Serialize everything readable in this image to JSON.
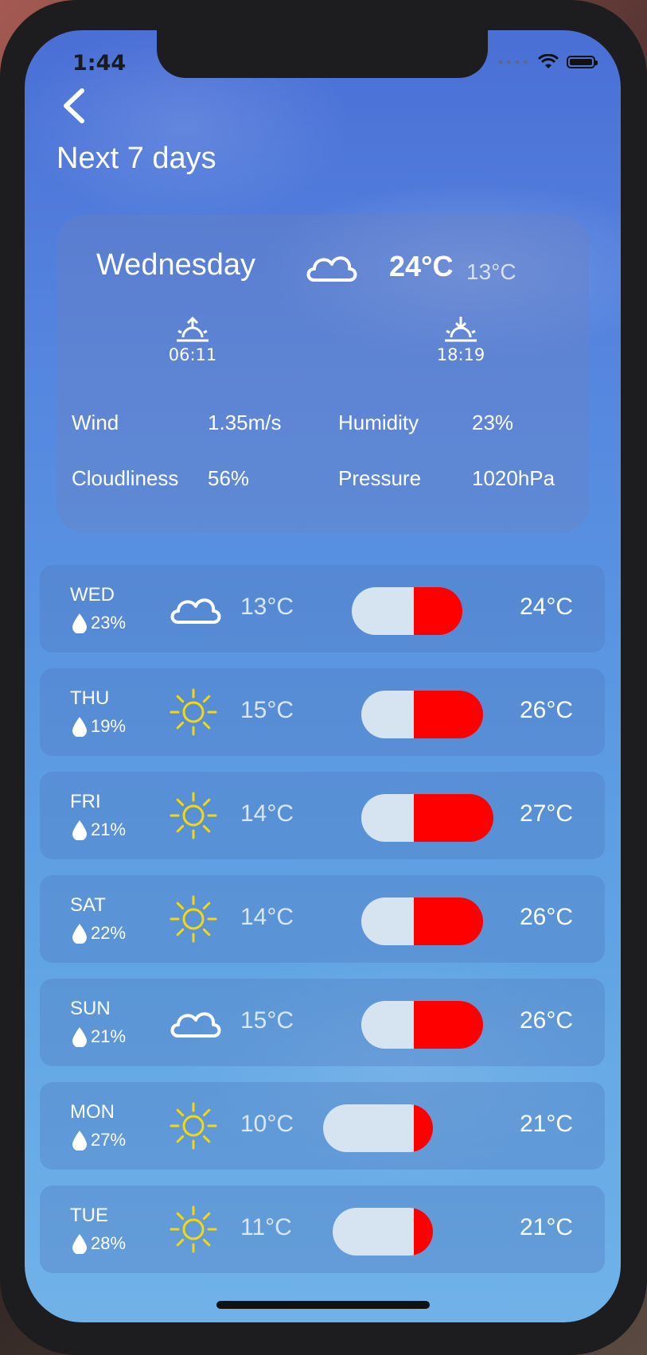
{
  "status": {
    "time": "1:44"
  },
  "header": {
    "title": "Next 7 days"
  },
  "summary": {
    "day": "Wednesday",
    "icon": "cloud-icon",
    "high": "24°C",
    "low": "13°C",
    "sunrise": "06:11",
    "sunset": "18:19",
    "metrics": {
      "wind_label": "Wind",
      "wind_value": "1.35m/s",
      "humidity_label": "Humidity",
      "humidity_value": "23%",
      "cloudiness_label": "Cloudliness",
      "cloudiness_value": "56%",
      "pressure_label": "Pressure",
      "pressure_value": "1020hPa"
    }
  },
  "colors": {
    "hot": "#ff0000",
    "cold": "#d6e4f2",
    "sun": "#f5d80a"
  },
  "forecast": [
    {
      "day": "WED",
      "precip": "23%",
      "icon": "cloud-icon",
      "low": "13°C",
      "high": "24°C",
      "low_value": 13,
      "high_value": 24
    },
    {
      "day": "THU",
      "precip": "19%",
      "icon": "sun-icon",
      "low": "15°C",
      "high": "26°C",
      "low_value": 15,
      "high_value": 26
    },
    {
      "day": "FRI",
      "precip": "21%",
      "icon": "sun-icon",
      "low": "14°C",
      "high": "27°C",
      "low_value": 14,
      "high_value": 27
    },
    {
      "day": "SAT",
      "precip": "22%",
      "icon": "sun-icon",
      "low": "14°C",
      "high": "26°C",
      "low_value": 14,
      "high_value": 26
    },
    {
      "day": "SUN",
      "precip": "21%",
      "icon": "cloud-icon",
      "low": "15°C",
      "high": "26°C",
      "low_value": 15,
      "high_value": 26
    },
    {
      "day": "MON",
      "precip": "27%",
      "icon": "sun-icon",
      "low": "10°C",
      "high": "21°C",
      "low_value": 10,
      "high_value": 21
    },
    {
      "day": "TUE",
      "precip": "28%",
      "icon": "sun-icon",
      "low": "11°C",
      "high": "21°C",
      "low_value": 11,
      "high_value": 21
    }
  ]
}
